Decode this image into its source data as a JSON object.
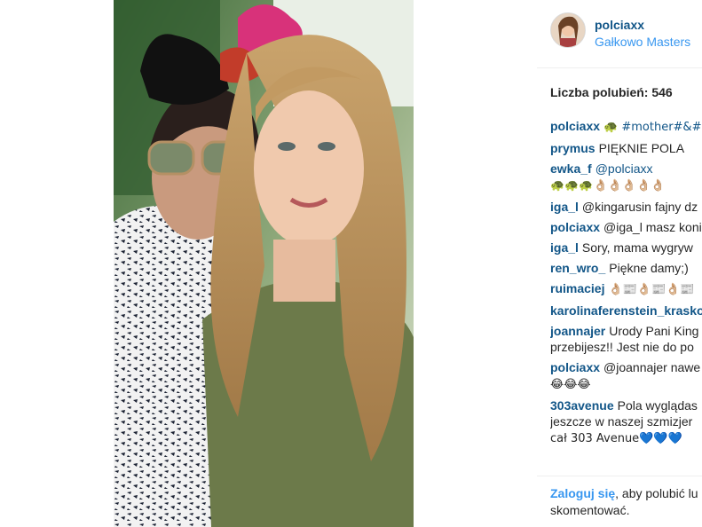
{
  "post": {
    "username": "polciaxx",
    "location": "Gałkowo Masters",
    "likes_text": "Liczba polubień: 546"
  },
  "comments": [
    {
      "user": "polciaxx",
      "text": "🐢 #mother#&#c",
      "tag": true
    },
    {
      "user": "prymus",
      "text": "PIĘKNIE POLA"
    },
    {
      "user": "ewka_f",
      "text": "@polciaxx",
      "tag": true,
      "line2": "🐢🐢🐢👌🏼👌🏼👌🏼👌🏼👌🏼"
    },
    {
      "user": "iga_l",
      "text": "@kingarusin fajny dz"
    },
    {
      "user": "polciaxx",
      "text": "@iga_l masz koni"
    },
    {
      "user": "iga_l",
      "text": "Sory, mama wygryw"
    },
    {
      "user": "ren_wro_",
      "text": "Piękne damy;)"
    },
    {
      "user": "ruimaciej",
      "text": "👌🏼📰👌🏼📰👌🏼📰"
    },
    {
      "user": "karolinaferenstein_krasko",
      "text": ""
    },
    {
      "user": "joannajer",
      "text": "Urody Pani King",
      "line2": "przebijesz!! Jest nie do po"
    },
    {
      "user": "polciaxx",
      "text": "@joannajer nawe",
      "line2": "😂😂😂"
    },
    {
      "user": "303avenue",
      "text": "Pola wyglądas",
      "line2": "jeszcze w naszej szmizjer",
      "line3": "cał 303 Avenue💙💙💙"
    }
  ],
  "footer": {
    "login_link": "Zaloguj się",
    "rest": ", aby polubić lu",
    "line2": "skomentować."
  },
  "colors": {
    "username": "#125688",
    "link": "#3897f0",
    "text": "#262626",
    "divider": "#efefef"
  }
}
